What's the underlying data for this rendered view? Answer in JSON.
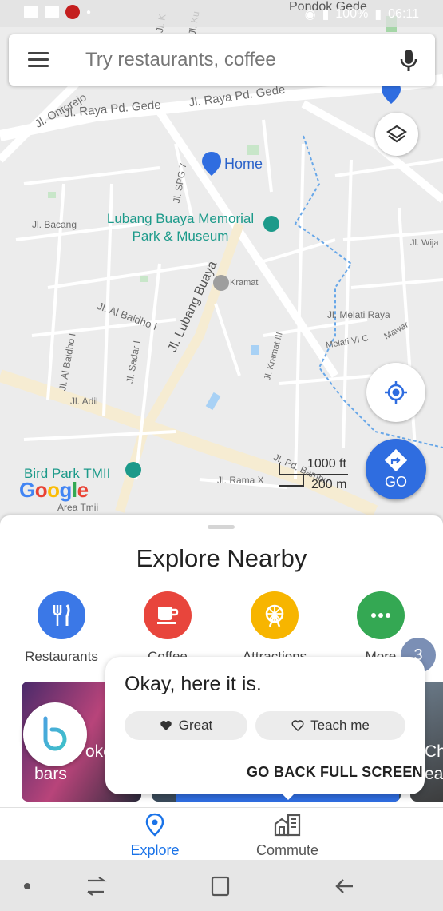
{
  "status_bar": {
    "battery": "100%",
    "time": "06:11",
    "location_partial": "Pondok Gede"
  },
  "search": {
    "placeholder": "Try restaurants, coffee"
  },
  "map": {
    "streets": [
      "Jl. Raya Pd. Gede",
      "Jl. Raya Pd. Gede",
      "Jl. Ontorejo",
      "Jl. Bacang",
      "Jl. SPG 7",
      "Jl. Al Baidho I",
      "Jl. Al Baidho I",
      "Jl. Adil",
      "Jl. Sadar I",
      "Jl. Lubang Buaya",
      "Kramat",
      "Jl. Kramat III",
      "Jl. Melati Raya",
      "Melati VI C",
      "Mawar",
      "Jl. Wija",
      "Jl. Rama X",
      "Jl. Pd. Bambu",
      "Area Tmii",
      "Jl. K",
      "Jl. Ku"
    ],
    "pois": {
      "home": "Home",
      "museum_line1": "Lubang Buaya Memorial",
      "museum_line2": "Park & Museum",
      "bird_park": "Bird Park TMII"
    },
    "scale_ft": "1000 ft",
    "scale_m": "200 m",
    "logo": "Google",
    "go_label": "GO"
  },
  "sheet": {
    "title": "Explore Nearby",
    "categories": [
      {
        "label": "Restaurants",
        "color": "#3b78e7"
      },
      {
        "label": "Coffee",
        "color": "#e8453c"
      },
      {
        "label": "Attractions",
        "color": "#f7b500"
      },
      {
        "label": "More",
        "color": "#34a853"
      }
    ],
    "badge": "3",
    "card_partial_text_1": "oke",
    "card_partial_text_2": "bars",
    "card_partial_right": "Ch",
    "card_partial_right2": "ea"
  },
  "bixby": {
    "message": "Okay, here it is.",
    "great": "Great",
    "teach": "Teach me",
    "go_back": "GO BACK",
    "full_screen": "FULL SCREEN"
  },
  "nav": {
    "explore": "Explore",
    "commute": "Commute",
    "active_color": "#1a73e8"
  }
}
